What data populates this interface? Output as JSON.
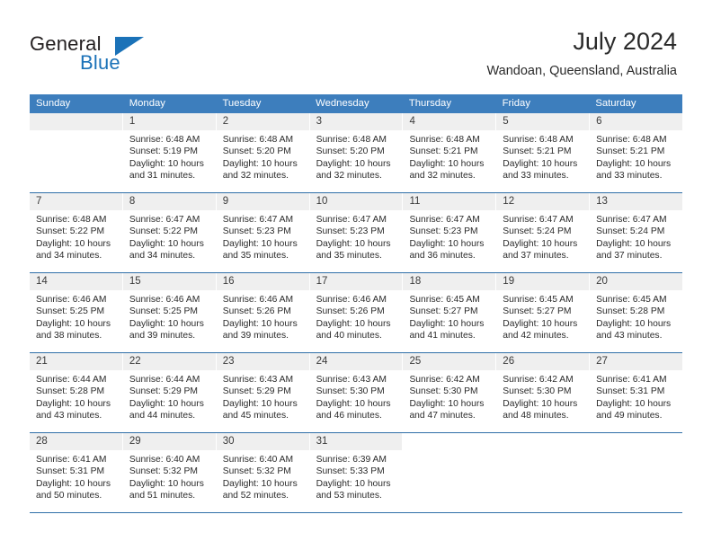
{
  "brand": {
    "name_part1": "General",
    "name_part2": "Blue",
    "accent_color": "#1b72b8"
  },
  "header": {
    "title": "July 2024",
    "subtitle": "Wandoan, Queensland, Australia"
  },
  "theme": {
    "header_row_bg": "#3d7ebd",
    "week_divider": "#2f6fa8",
    "daynum_bg": "#efefef"
  },
  "calendar": {
    "weekday_headers": [
      "Sunday",
      "Monday",
      "Tuesday",
      "Wednesday",
      "Thursday",
      "Friday",
      "Saturday"
    ],
    "labels": {
      "sunrise": "Sunrise:",
      "sunset": "Sunset:",
      "daylight": "Daylight:"
    },
    "weeks": [
      [
        {
          "day": "",
          "empty": true
        },
        {
          "day": "1",
          "sunrise": "Sunrise: 6:48 AM",
          "sunset": "Sunset: 5:19 PM",
          "daylight1": "Daylight: 10 hours",
          "daylight2": "and 31 minutes."
        },
        {
          "day": "2",
          "sunrise": "Sunrise: 6:48 AM",
          "sunset": "Sunset: 5:20 PM",
          "daylight1": "Daylight: 10 hours",
          "daylight2": "and 32 minutes."
        },
        {
          "day": "3",
          "sunrise": "Sunrise: 6:48 AM",
          "sunset": "Sunset: 5:20 PM",
          "daylight1": "Daylight: 10 hours",
          "daylight2": "and 32 minutes."
        },
        {
          "day": "4",
          "sunrise": "Sunrise: 6:48 AM",
          "sunset": "Sunset: 5:21 PM",
          "daylight1": "Daylight: 10 hours",
          "daylight2": "and 32 minutes."
        },
        {
          "day": "5",
          "sunrise": "Sunrise: 6:48 AM",
          "sunset": "Sunset: 5:21 PM",
          "daylight1": "Daylight: 10 hours",
          "daylight2": "and 33 minutes."
        },
        {
          "day": "6",
          "sunrise": "Sunrise: 6:48 AM",
          "sunset": "Sunset: 5:21 PM",
          "daylight1": "Daylight: 10 hours",
          "daylight2": "and 33 minutes."
        }
      ],
      [
        {
          "day": "7",
          "sunrise": "Sunrise: 6:48 AM",
          "sunset": "Sunset: 5:22 PM",
          "daylight1": "Daylight: 10 hours",
          "daylight2": "and 34 minutes."
        },
        {
          "day": "8",
          "sunrise": "Sunrise: 6:47 AM",
          "sunset": "Sunset: 5:22 PM",
          "daylight1": "Daylight: 10 hours",
          "daylight2": "and 34 minutes."
        },
        {
          "day": "9",
          "sunrise": "Sunrise: 6:47 AM",
          "sunset": "Sunset: 5:23 PM",
          "daylight1": "Daylight: 10 hours",
          "daylight2": "and 35 minutes."
        },
        {
          "day": "10",
          "sunrise": "Sunrise: 6:47 AM",
          "sunset": "Sunset: 5:23 PM",
          "daylight1": "Daylight: 10 hours",
          "daylight2": "and 35 minutes."
        },
        {
          "day": "11",
          "sunrise": "Sunrise: 6:47 AM",
          "sunset": "Sunset: 5:23 PM",
          "daylight1": "Daylight: 10 hours",
          "daylight2": "and 36 minutes."
        },
        {
          "day": "12",
          "sunrise": "Sunrise: 6:47 AM",
          "sunset": "Sunset: 5:24 PM",
          "daylight1": "Daylight: 10 hours",
          "daylight2": "and 37 minutes."
        },
        {
          "day": "13",
          "sunrise": "Sunrise: 6:47 AM",
          "sunset": "Sunset: 5:24 PM",
          "daylight1": "Daylight: 10 hours",
          "daylight2": "and 37 minutes."
        }
      ],
      [
        {
          "day": "14",
          "sunrise": "Sunrise: 6:46 AM",
          "sunset": "Sunset: 5:25 PM",
          "daylight1": "Daylight: 10 hours",
          "daylight2": "and 38 minutes."
        },
        {
          "day": "15",
          "sunrise": "Sunrise: 6:46 AM",
          "sunset": "Sunset: 5:25 PM",
          "daylight1": "Daylight: 10 hours",
          "daylight2": "and 39 minutes."
        },
        {
          "day": "16",
          "sunrise": "Sunrise: 6:46 AM",
          "sunset": "Sunset: 5:26 PM",
          "daylight1": "Daylight: 10 hours",
          "daylight2": "and 39 minutes."
        },
        {
          "day": "17",
          "sunrise": "Sunrise: 6:46 AM",
          "sunset": "Sunset: 5:26 PM",
          "daylight1": "Daylight: 10 hours",
          "daylight2": "and 40 minutes."
        },
        {
          "day": "18",
          "sunrise": "Sunrise: 6:45 AM",
          "sunset": "Sunset: 5:27 PM",
          "daylight1": "Daylight: 10 hours",
          "daylight2": "and 41 minutes."
        },
        {
          "day": "19",
          "sunrise": "Sunrise: 6:45 AM",
          "sunset": "Sunset: 5:27 PM",
          "daylight1": "Daylight: 10 hours",
          "daylight2": "and 42 minutes."
        },
        {
          "day": "20",
          "sunrise": "Sunrise: 6:45 AM",
          "sunset": "Sunset: 5:28 PM",
          "daylight1": "Daylight: 10 hours",
          "daylight2": "and 43 minutes."
        }
      ],
      [
        {
          "day": "21",
          "sunrise": "Sunrise: 6:44 AM",
          "sunset": "Sunset: 5:28 PM",
          "daylight1": "Daylight: 10 hours",
          "daylight2": "and 43 minutes."
        },
        {
          "day": "22",
          "sunrise": "Sunrise: 6:44 AM",
          "sunset": "Sunset: 5:29 PM",
          "daylight1": "Daylight: 10 hours",
          "daylight2": "and 44 minutes."
        },
        {
          "day": "23",
          "sunrise": "Sunrise: 6:43 AM",
          "sunset": "Sunset: 5:29 PM",
          "daylight1": "Daylight: 10 hours",
          "daylight2": "and 45 minutes."
        },
        {
          "day": "24",
          "sunrise": "Sunrise: 6:43 AM",
          "sunset": "Sunset: 5:30 PM",
          "daylight1": "Daylight: 10 hours",
          "daylight2": "and 46 minutes."
        },
        {
          "day": "25",
          "sunrise": "Sunrise: 6:42 AM",
          "sunset": "Sunset: 5:30 PM",
          "daylight1": "Daylight: 10 hours",
          "daylight2": "and 47 minutes."
        },
        {
          "day": "26",
          "sunrise": "Sunrise: 6:42 AM",
          "sunset": "Sunset: 5:30 PM",
          "daylight1": "Daylight: 10 hours",
          "daylight2": "and 48 minutes."
        },
        {
          "day": "27",
          "sunrise": "Sunrise: 6:41 AM",
          "sunset": "Sunset: 5:31 PM",
          "daylight1": "Daylight: 10 hours",
          "daylight2": "and 49 minutes."
        }
      ],
      [
        {
          "day": "28",
          "sunrise": "Sunrise: 6:41 AM",
          "sunset": "Sunset: 5:31 PM",
          "daylight1": "Daylight: 10 hours",
          "daylight2": "and 50 minutes."
        },
        {
          "day": "29",
          "sunrise": "Sunrise: 6:40 AM",
          "sunset": "Sunset: 5:32 PM",
          "daylight1": "Daylight: 10 hours",
          "daylight2": "and 51 minutes."
        },
        {
          "day": "30",
          "sunrise": "Sunrise: 6:40 AM",
          "sunset": "Sunset: 5:32 PM",
          "daylight1": "Daylight: 10 hours",
          "daylight2": "and 52 minutes."
        },
        {
          "day": "31",
          "sunrise": "Sunrise: 6:39 AM",
          "sunset": "Sunset: 5:33 PM",
          "daylight1": "Daylight: 10 hours",
          "daylight2": "and 53 minutes."
        },
        {
          "day": "",
          "empty": true,
          "blank_cell": true
        },
        {
          "day": "",
          "empty": true,
          "blank_cell": true
        },
        {
          "day": "",
          "empty": true,
          "blank_cell": true
        }
      ]
    ]
  }
}
